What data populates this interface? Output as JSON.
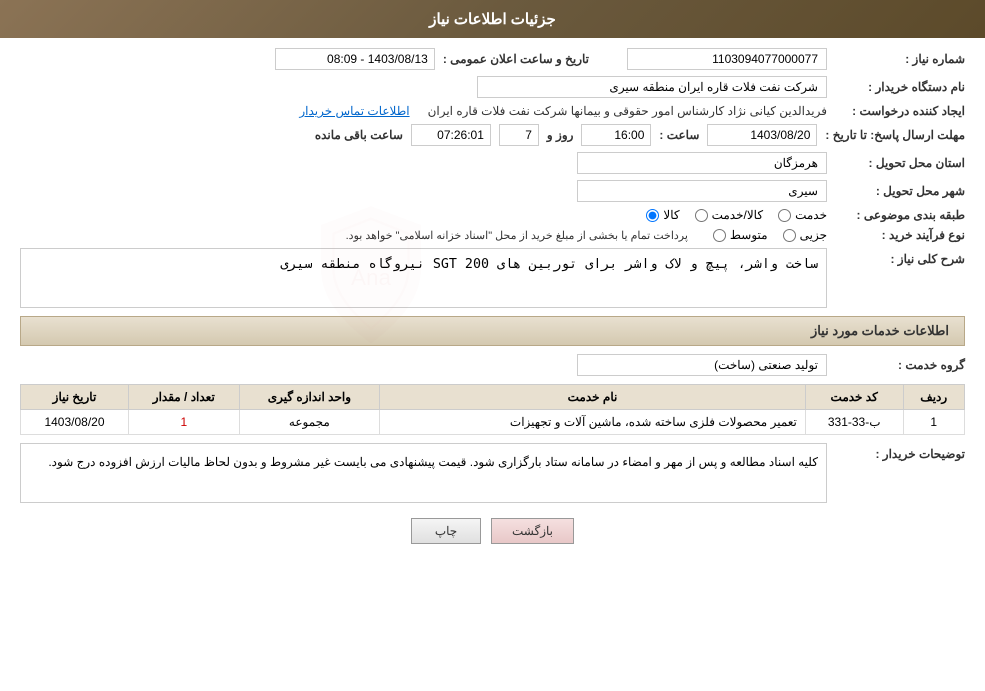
{
  "header": {
    "title": "جزئیات اطلاعات نیاز"
  },
  "fields": {
    "need_number_label": "شماره نیاز :",
    "need_number_value": "1103094077000077",
    "buyer_org_label": "نام دستگاه خریدار :",
    "buyer_org_value": "شرکت نفت فلات قاره ایران منطقه سیری",
    "creator_label": "ایجاد کننده درخواست :",
    "creator_value": "فریدالدین کیانی نژاد کارشناس امور حقوقی و بیمانها شرکت نفت فلات قاره ایران",
    "contact_link": "اطلاعات تماس خریدار",
    "send_deadline_label": "مهلت ارسال پاسخ: تا تاریخ :",
    "send_date_value": "1403/08/20",
    "send_time_label": "ساعت :",
    "send_time_value": "16:00",
    "send_days_label": "روز و",
    "send_days_value": "7",
    "send_remaining_label": "ساعت باقی مانده",
    "send_remaining_value": "07:26:01",
    "announce_date_label": "تاریخ و ساعت اعلان عمومی :",
    "announce_date_value": "1403/08/13 - 08:09",
    "province_label": "استان محل تحویل :",
    "province_value": "هرمزگان",
    "city_label": "شهر محل تحویل :",
    "city_value": "سیری",
    "category_label": "طبقه بندی موضوعی :",
    "category_options": [
      "خدمت",
      "کالا/خدمت",
      "کالا"
    ],
    "category_selected": "کالا",
    "purchase_type_label": "نوع فرآیند خرید :",
    "purchase_options": [
      "جزیی",
      "متوسط"
    ],
    "purchase_note": "پرداخت تمام یا بخشی از مبلغ خرید از محل \"اسناد خزانه اسلامی\" خواهد بود.",
    "need_desc_label": "شرح کلی نیاز :",
    "need_desc_value": "ساخت واشر، پیچ و لاک واشر برای توربین های SGT 200 نیروگاه منطقه سیری",
    "services_section_title": "اطلاعات خدمات مورد نیاز",
    "service_group_label": "گروه خدمت :",
    "service_group_value": "تولید صنعتی (ساخت)",
    "table": {
      "headers": [
        "ردیف",
        "کد خدمت",
        "نام خدمت",
        "واحد اندازه گیری",
        "تعداد / مقدار",
        "تاریخ نیاز"
      ],
      "rows": [
        {
          "row_num": "1",
          "code": "ب-33-331",
          "name": "تعمیر محصولات فلزی ساخته شده، ماشین آلات و تجهیزات",
          "unit": "مجموعه",
          "quantity": "1",
          "date": "1403/08/20"
        }
      ]
    },
    "buyer_notes_label": "توضیحات خریدار :",
    "buyer_notes_value": "کلیه اسناد مطالعه و پس از مهر و امضاء در سامانه ستاد بارگزاری شود. قیمت پیشنهادی می بایست غیر مشروط و بدون لحاظ مالیات ارزش افزوده درج شود."
  },
  "buttons": {
    "print_label": "چاپ",
    "back_label": "بازگشت"
  }
}
